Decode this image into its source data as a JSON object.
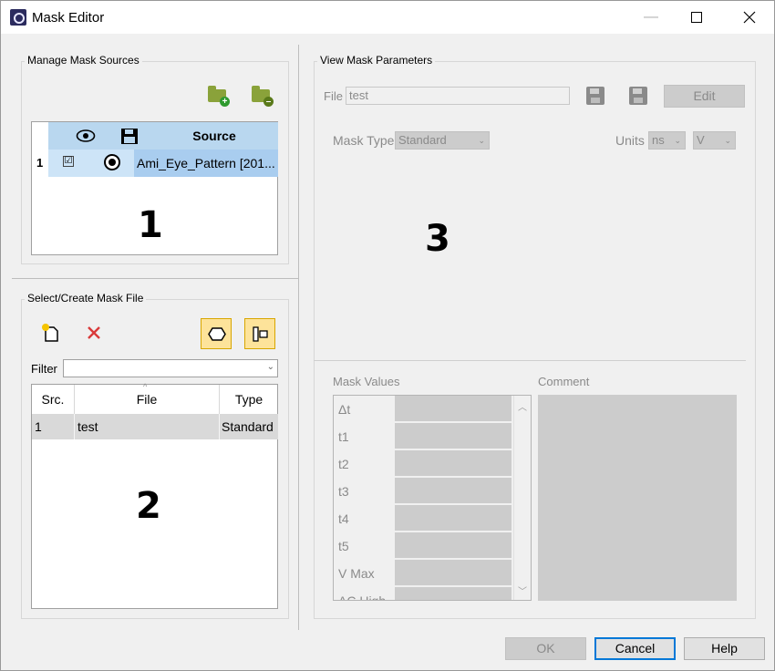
{
  "window": {
    "title": "Mask Editor"
  },
  "sources": {
    "group_title": "Manage Mask Sources",
    "header": {
      "source": "Source"
    },
    "rows": [
      {
        "num": "1",
        "checked": "☑",
        "source": "Ami_Eye_Pattern  [201..."
      }
    ],
    "marker": "1"
  },
  "files": {
    "group_title": "Select/Create Mask File",
    "filter_label": "Filter",
    "filter_value": "",
    "columns": [
      "Src.",
      "File",
      "Type"
    ],
    "rows": [
      {
        "src": "1",
        "file": "test",
        "type": "Standard"
      }
    ],
    "marker": "2"
  },
  "params": {
    "group_title": "View Mask Parameters",
    "file_label": "File",
    "file_value": "test",
    "edit_label": "Edit",
    "mask_type_label": "Mask Type",
    "mask_type_value": "Standard",
    "units_label": "Units",
    "units_time": "ns",
    "units_voltage": "V",
    "marker": "3",
    "mask_values_label": "Mask Values",
    "comment_label": "Comment",
    "mask_values": [
      "Δt",
      "t1",
      "t2",
      "t3",
      "t4",
      "t5",
      "V Max",
      "AC High"
    ]
  },
  "buttons": {
    "ok": "OK",
    "cancel": "Cancel",
    "help": "Help"
  }
}
